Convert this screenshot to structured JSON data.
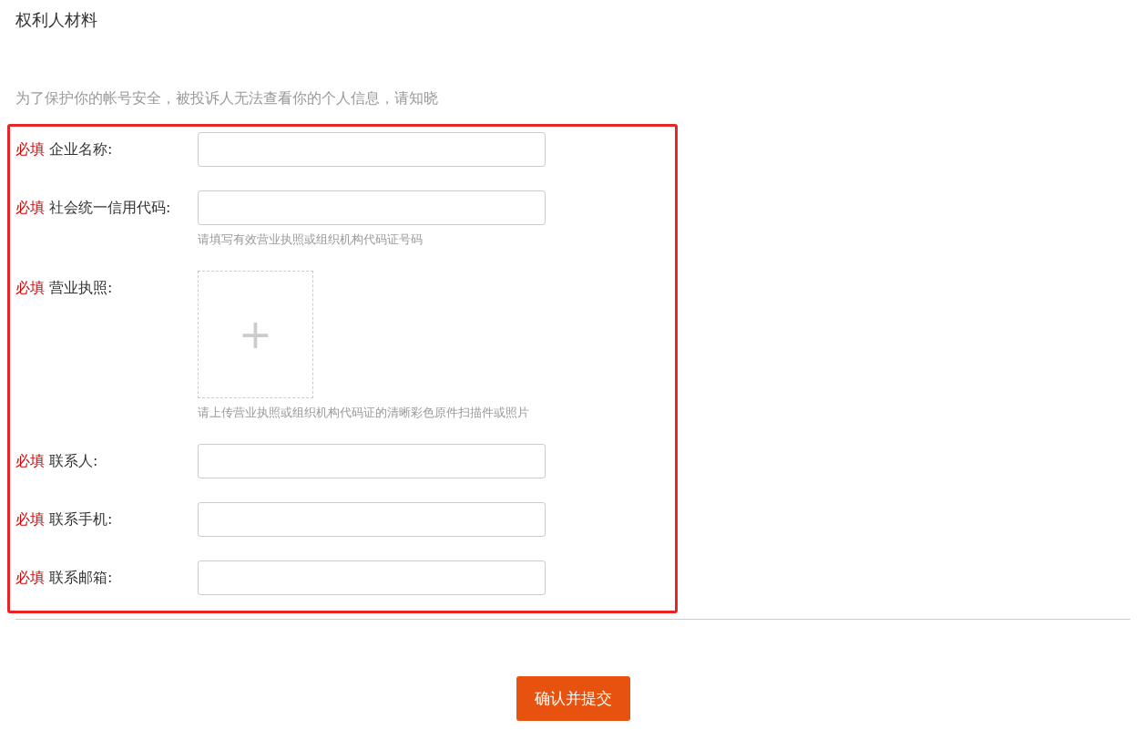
{
  "section_title": "权利人材料",
  "notice": "为了保护你的帐号安全，被投诉人无法查看你的个人信息，请知晓",
  "fields": [
    {
      "kind": "text",
      "required_mark": "必填",
      "label": "企业名称:"
    },
    {
      "kind": "text",
      "required_mark": "必填",
      "label": "社会统一信用代码:",
      "hint": "请填写有效营业执照或组织机构代码证号码"
    },
    {
      "kind": "upload",
      "required_mark": "必填",
      "label": "营业执照:",
      "upload_symbol": "+",
      "hint": "请上传营业执照或组织机构代码证的清晰彩色原件扫描件或照片"
    },
    {
      "kind": "text",
      "required_mark": "必填",
      "label": "联系人:"
    },
    {
      "kind": "text",
      "required_mark": "必填",
      "label": "联系手机:"
    },
    {
      "kind": "text",
      "required_mark": "必填",
      "label": "联系邮箱:"
    }
  ],
  "submit_button": "确认并提交"
}
